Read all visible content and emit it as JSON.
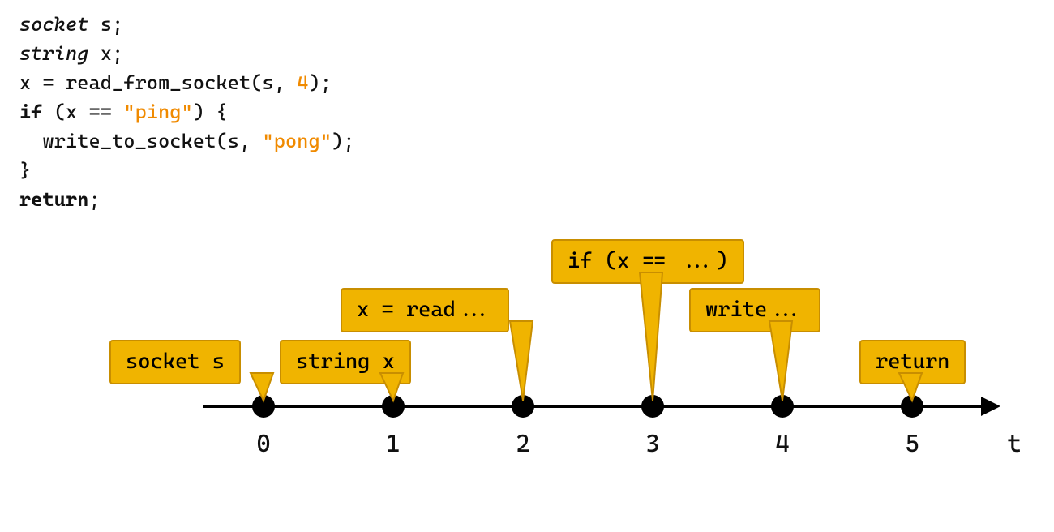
{
  "code": {
    "line1_type": "socket",
    "line1_rest": " s;",
    "line2_type": "string",
    "line2_rest": " x;",
    "line3_a": "x = read_from_socket(s, ",
    "line3_lit": "4",
    "line3_b": ");",
    "line4_kw": "if",
    "line4_a": " (x == ",
    "line4_lit": "\"ping\"",
    "line4_b": ") {",
    "line5_a": "  write_to_socket(s, ",
    "line5_lit": "\"pong\"",
    "line5_b": ");",
    "line6": "}",
    "line7_kw": "return",
    "line7_b": ";"
  },
  "timeline": {
    "axis_label": "t",
    "ticks": [
      "0",
      "1",
      "2",
      "3",
      "4",
      "5"
    ],
    "callouts": [
      {
        "key": "c0",
        "label": "socket s"
      },
      {
        "key": "c1",
        "label": "string x"
      },
      {
        "key": "c2",
        "label": "x = read..."
      },
      {
        "key": "c3",
        "label": "if (x == ...)"
      },
      {
        "key": "c4",
        "label": "write..."
      },
      {
        "key": "c5",
        "label": "return"
      }
    ]
  },
  "colors": {
    "literal": "#f08a00",
    "callout_fill": "#f0b400",
    "callout_border": "#c88e00"
  }
}
